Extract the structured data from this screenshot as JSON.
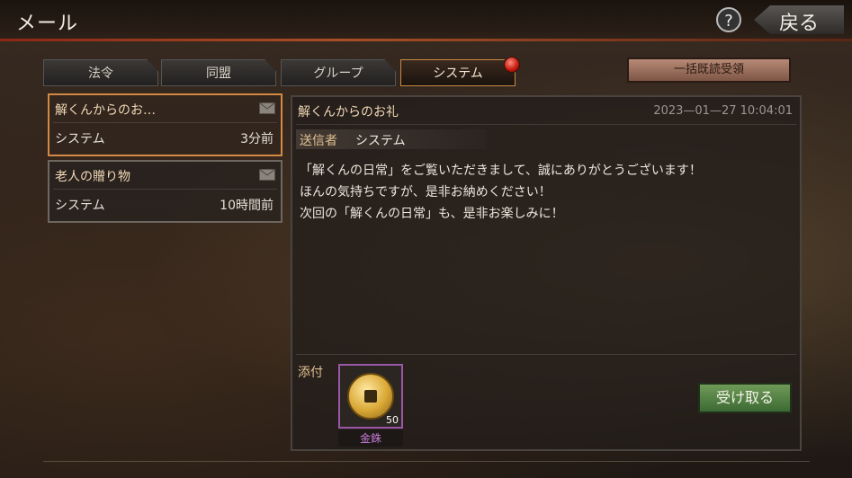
{
  "header": {
    "title": "メール",
    "help_label": "?",
    "back_label": "戻る"
  },
  "tabs": [
    {
      "label": "法令"
    },
    {
      "label": "同盟"
    },
    {
      "label": "グループ"
    },
    {
      "label": "システム",
      "active": true
    }
  ],
  "bulk_button": "一括既読受領",
  "mail_list": [
    {
      "subject": "解くんからのお…",
      "sender": "システム",
      "time": "3分前",
      "selected": true
    },
    {
      "subject": "老人の贈り物",
      "sender": "システム",
      "time": "10時間前"
    }
  ],
  "detail": {
    "subject": "解くんからのお礼",
    "date": "2023—01—27 10:04:01",
    "sender_label": "送信者",
    "sender_value": "システム",
    "body_lines": [
      "「解くんの日常」をご覧いただきまして、誠にありがとうございます！",
      "ほんの気持ちですが、是非お納めください！",
      "次回の「解くんの日常」も、是非お楽しみに！"
    ],
    "attachment_label": "添付",
    "attachment": {
      "name": "金銖",
      "quantity": "50"
    },
    "receive_button": "受け取る"
  },
  "colors": {
    "accent_border": "#d48a45",
    "item_rarity": "#9b57a8",
    "receive_green": "#4f7d42"
  },
  "icons": [
    "help-icon",
    "back-arrow-icon",
    "envelope-icon",
    "coin-icon",
    "notification-dot-icon"
  ]
}
